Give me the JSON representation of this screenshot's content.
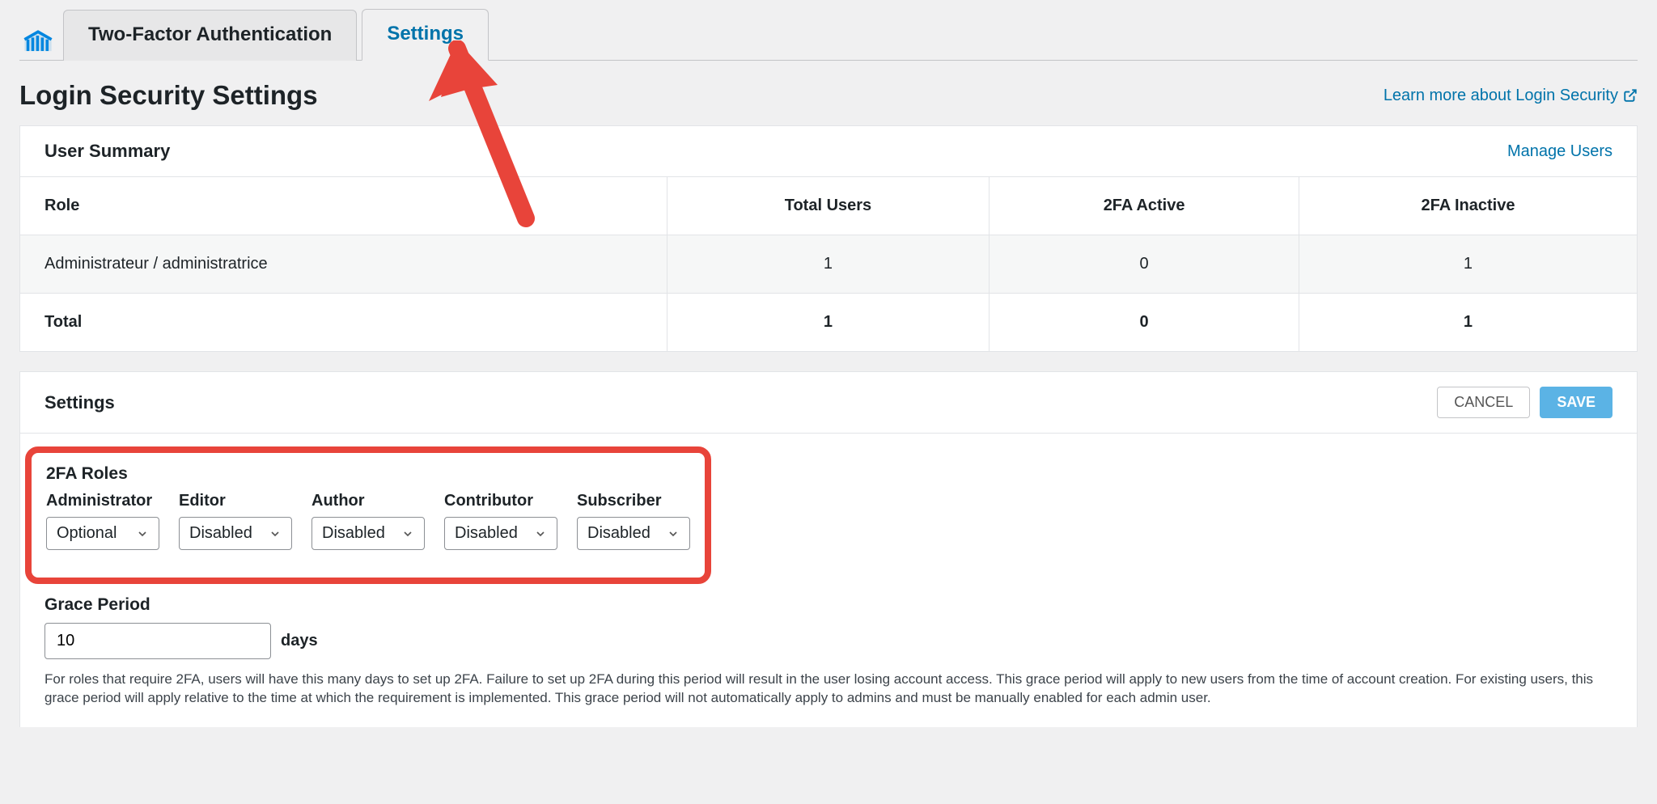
{
  "tabs": {
    "twofa": "Two-Factor Authentication",
    "settings": "Settings"
  },
  "page_title": "Login Security Settings",
  "learn_more": "Learn more about Login Security",
  "user_summary": {
    "title": "User Summary",
    "manage": "Manage Users",
    "headers": {
      "role": "Role",
      "total": "Total Users",
      "active": "2FA Active",
      "inactive": "2FA Inactive"
    },
    "rows": [
      {
        "role": "Administrateur / administratrice",
        "total": "1",
        "active": "0",
        "inactive": "1"
      }
    ],
    "totals": {
      "label": "Total",
      "total": "1",
      "active": "0",
      "inactive": "1"
    }
  },
  "settings": {
    "title": "Settings",
    "cancel": "CANCEL",
    "save": "SAVE",
    "roles_title": "2FA Roles",
    "roles": {
      "administrator": {
        "label": "Administrator",
        "value": "Optional"
      },
      "editor": {
        "label": "Editor",
        "value": "Disabled"
      },
      "author": {
        "label": "Author",
        "value": "Disabled"
      },
      "contributor": {
        "label": "Contributor",
        "value": "Disabled"
      },
      "subscriber": {
        "label": "Subscriber",
        "value": "Disabled"
      }
    },
    "grace": {
      "title": "Grace Period",
      "value": "10",
      "unit": "days",
      "help": "For roles that require 2FA, users will have this many days to set up 2FA. Failure to set up 2FA during this period will result in the user losing account access. This grace period will apply to new users from the time of account creation. For existing users, this grace period will apply relative to the time at which the requirement is implemented. This grace period will not automatically apply to admins and must be manually enabled for each admin user."
    }
  }
}
